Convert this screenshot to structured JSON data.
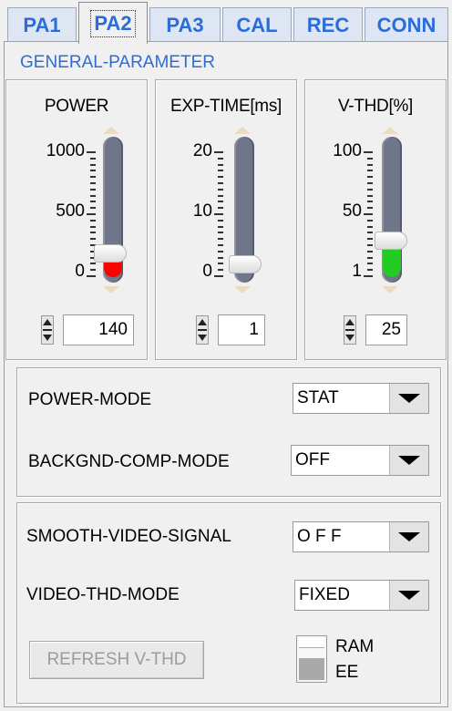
{
  "tabs": [
    {
      "label": "PA1",
      "active": false
    },
    {
      "label": "PA2",
      "active": true
    },
    {
      "label": "PA3",
      "active": false
    },
    {
      "label": "CAL",
      "active": false
    },
    {
      "label": "REC",
      "active": false
    },
    {
      "label": "CONN",
      "active": false
    }
  ],
  "group_title": "GENERAL-PARAMETER",
  "sliders": [
    {
      "title": "POWER",
      "scale": [
        "1000",
        "500",
        "0"
      ],
      "value": "140",
      "level_fraction": 0.14,
      "indicator_color": "#ff0000"
    },
    {
      "title": "EXP-TIME[ms]",
      "scale": [
        "20",
        "10",
        "0"
      ],
      "value": "1",
      "level_fraction": 0.05,
      "indicator_color": "#0000ff"
    },
    {
      "title": "V-THD[%]",
      "scale": [
        "100",
        "50",
        "1"
      ],
      "value": "25",
      "level_fraction": 0.24,
      "indicator_color": "#22cc22"
    }
  ],
  "modes": {
    "power_mode": {
      "label": "POWER-MODE",
      "value": "STAT"
    },
    "backgnd_comp_mode": {
      "label": "BACKGND-COMP-MODE",
      "value": "OFF"
    },
    "smooth_video_signal": {
      "label": "SMOOTH-VIDEO-SIGNAL",
      "value": "O F F"
    },
    "video_thd_mode": {
      "label": "VIDEO-THD-MODE",
      "value": "FIXED"
    }
  },
  "refresh_button": {
    "label": "REFRESH V-THD",
    "enabled": false
  },
  "memory_switch": {
    "top_label": "RAM",
    "bottom_label": "EE",
    "selected": "EE"
  }
}
